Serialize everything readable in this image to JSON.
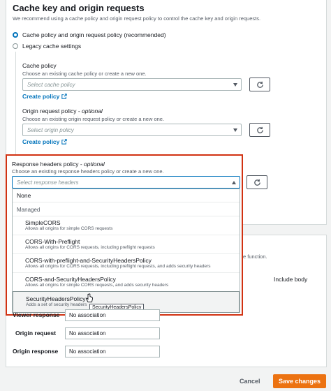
{
  "section": {
    "title": "Cache key and origin requests",
    "description": "We recommend using a cache policy and origin request policy to control the cache key and origin requests."
  },
  "options": {
    "recommended": "Cache policy and origin request policy (recommended)",
    "legacy": "Legacy cache settings"
  },
  "cache_policy": {
    "label": "Cache policy",
    "description": "Choose an existing cache policy or create a new one.",
    "placeholder": "Select cache policy",
    "create_link": "Create policy"
  },
  "origin_request_policy": {
    "label": "Origin request policy",
    "optional": "optional",
    "description": "Choose an existing origin request policy or create a new one.",
    "placeholder": "Select origin policy",
    "create_link": "Create policy"
  },
  "response_headers_policy": {
    "label": "Response headers policy",
    "optional": "optional",
    "description": "Choose an existing response headers policy or create a new one.",
    "placeholder": "Select response headers"
  },
  "dropdown": {
    "none": "None",
    "group": "Managed",
    "items": [
      {
        "title": "SimpleCORS",
        "desc": "Allows all origins for simple CORS requests"
      },
      {
        "title": "CORS-With-Preflight",
        "desc": "Allows all origins for CORS requests, including preflight requests"
      },
      {
        "title": "CORS-with-preflight-and-SecurityHeadersPolicy",
        "desc": "Allows all origins for CORS requests, including preflight requests, and adds security headers"
      },
      {
        "title": "CORS-and-SecurityHeadersPolicy",
        "desc": "Allows all origins for simple CORS requests, and adds security headers"
      },
      {
        "title": "SecurityHeadersPolicy",
        "desc": "Adds a set of security headers"
      }
    ],
    "tooltip": "SecurityHeadersPolicy"
  },
  "functions": {
    "partial_desc": "e function.",
    "include_body": "Include body",
    "rows": [
      {
        "label": "Viewer response",
        "value": "No association"
      },
      {
        "label": "Origin request",
        "value": "No association"
      },
      {
        "label": "Origin response",
        "value": "No association"
      }
    ]
  },
  "footer": {
    "cancel": "Cancel",
    "save": "Save changes"
  },
  "colors": {
    "accent": "#0073bb",
    "save_button": "#ec7211",
    "highlight_border": "#d13212"
  }
}
